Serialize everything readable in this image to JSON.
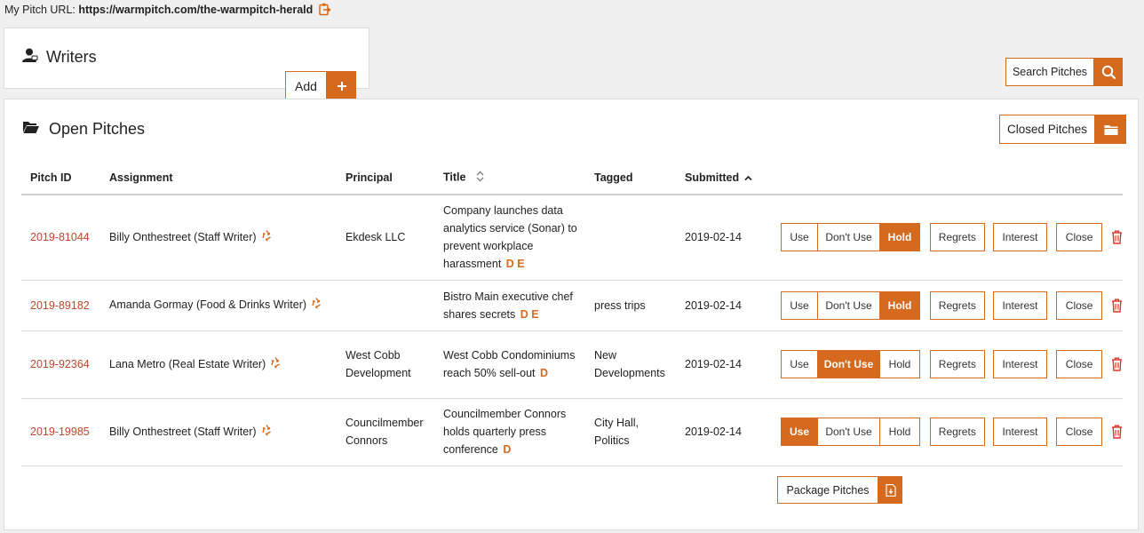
{
  "header": {
    "label": "My Pitch URL:",
    "url": "https://warmpitch.com/the-warmpitch-herald"
  },
  "writers": {
    "title": "Writers",
    "add_label": "Add",
    "add_icon": "plus-icon"
  },
  "search": {
    "label": "Search Pitches",
    "icon": "search-icon"
  },
  "open_pitches": {
    "title": "Open Pitches",
    "closed_label": "Closed Pitches",
    "columns": [
      "Pitch ID",
      "Assignment",
      "Principal",
      "Title",
      "Tagged",
      "Submitted"
    ],
    "rows": [
      {
        "id": "2019-81044",
        "assignment": "Billy Onthestreet (Staff Writer)",
        "principal": "Ekdesk LLC",
        "title": "Company launches data analytics service (Sonar) to prevent workplace harassment",
        "flags": "D E",
        "tagged": "",
        "submitted": "2019-02-14",
        "selected": "Hold"
      },
      {
        "id": "2019-89182",
        "assignment": "Amanda Gormay (Food & Drinks Writer)",
        "principal": "",
        "title": "Bistro Main executive chef shares secrets",
        "flags": "D E",
        "tagged": "press trips",
        "submitted": "2019-02-14",
        "selected": "Hold"
      },
      {
        "id": "2019-92364",
        "assignment": "Lana Metro (Real Estate Writer)",
        "principal": "West Cobb Development",
        "title": "West Cobb Condominiums reach 50% sell-out",
        "flags": "D",
        "tagged": "New Developments",
        "submitted": "2019-02-14",
        "selected": "Don't Use"
      },
      {
        "id": "2019-19985",
        "assignment": "Billy Onthestreet (Staff Writer)",
        "principal": "Councilmember Connors",
        "title": "Councilmember Connors holds quarterly press conference",
        "flags": "D",
        "tagged": "City Hall, Politics",
        "submitted": "2019-02-14",
        "selected": "Use"
      }
    ],
    "action_labels": {
      "use": "Use",
      "dont_use": "Don't Use",
      "hold": "Hold",
      "regrets": "Regrets",
      "interest": "Interest",
      "close": "Close"
    },
    "package_label": "Package Pitches"
  },
  "colors": {
    "accent": "#d5691e",
    "link": "#c0452a",
    "trash": "#e0322d"
  }
}
